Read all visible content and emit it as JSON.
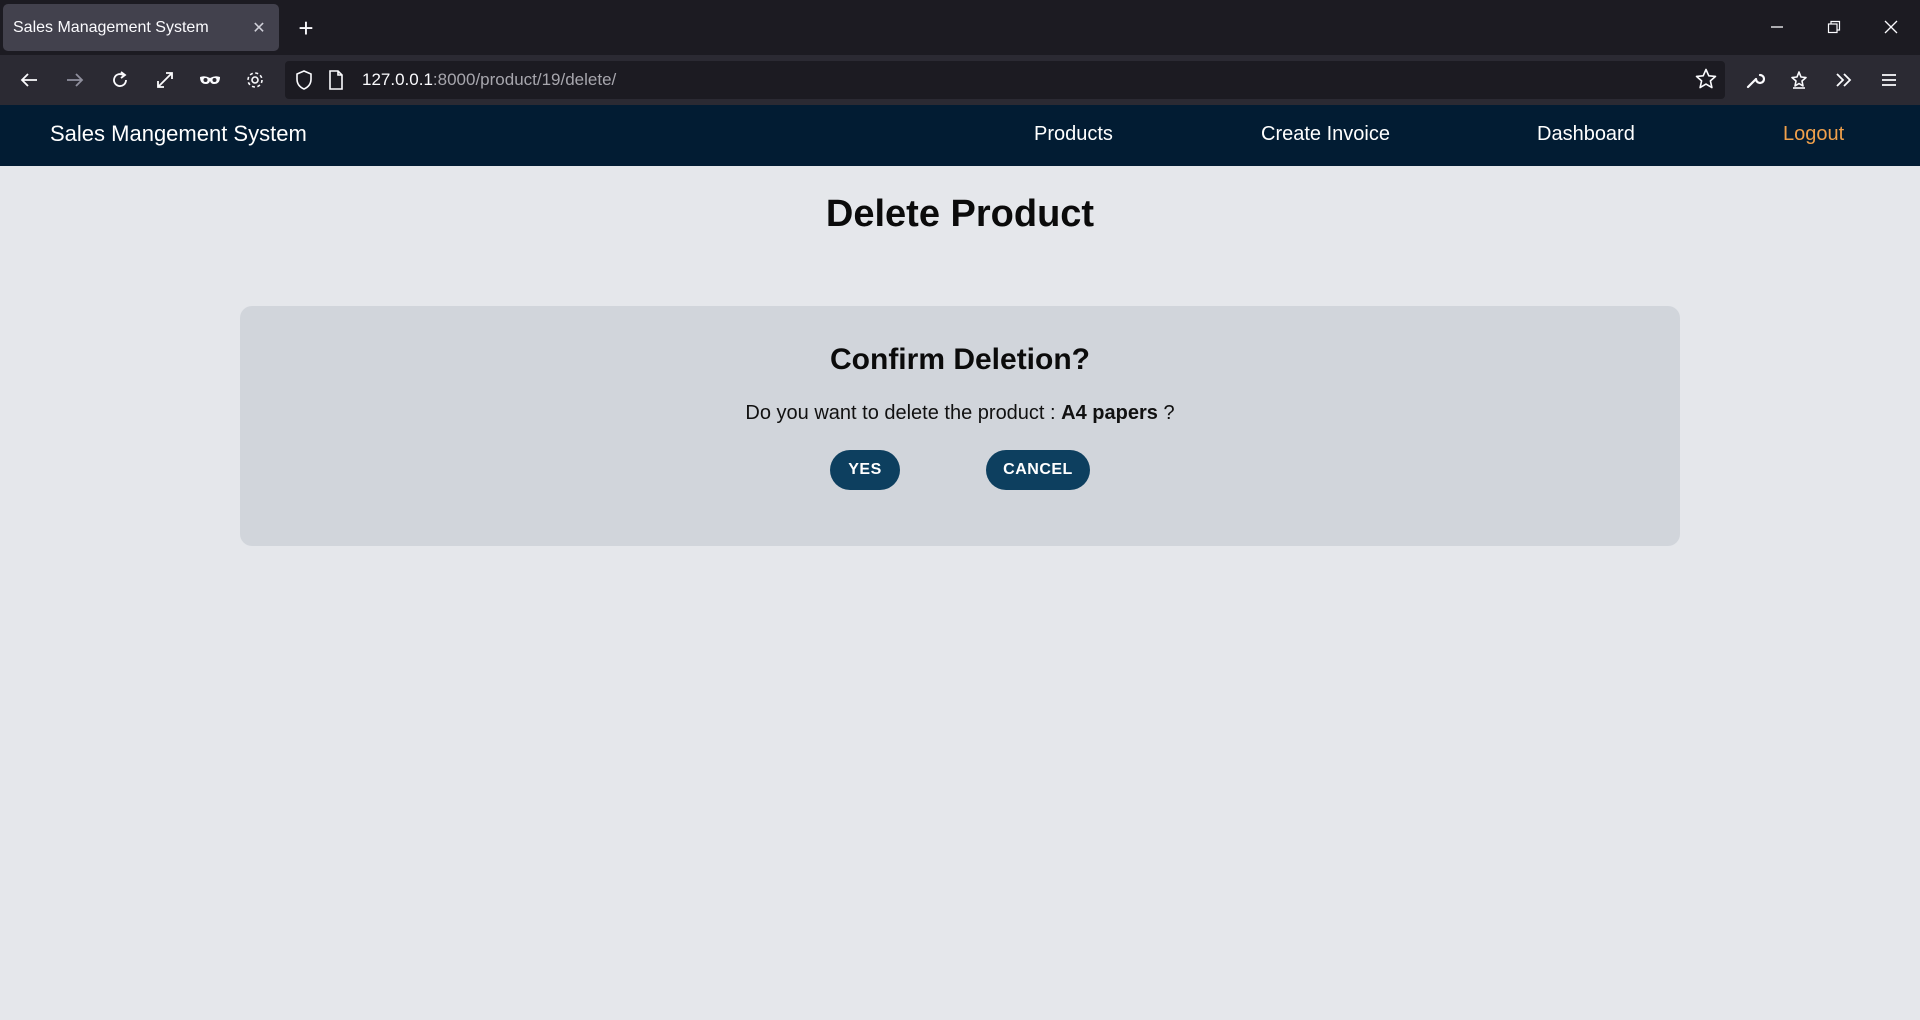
{
  "browser": {
    "tab_title": "Sales Management System",
    "tab_close": "✕",
    "new_tab": "+",
    "url_host": "127.0.0.1",
    "url_rest": ":8000/product/19/delete/"
  },
  "site": {
    "brand": "Sales Mangement System",
    "menu": {
      "products": "Products",
      "create_invoice": "Create Invoice",
      "dashboard": "Dashboard",
      "logout": "Logout"
    },
    "logout_color": "#f0a04b",
    "header_color": "#021c33"
  },
  "page": {
    "title": "Delete Product",
    "card": {
      "heading": "Confirm Deletion?",
      "prompt_prefix": "Do you want to delete the product : ",
      "product_name": "A4 papers",
      "prompt_suffix": " ?",
      "yes_label": "YES",
      "cancel_label": "CANCEL"
    },
    "button_color": "#0d3f5f"
  },
  "icons": [
    "back-icon",
    "forward-icon",
    "reload-icon",
    "fullscreen-icon",
    "mask-icon",
    "gear-icon",
    "shield-icon",
    "page-icon",
    "star-icon",
    "wrench-icon",
    "extensions-icon",
    "overflow-icon",
    "menu-icon"
  ]
}
